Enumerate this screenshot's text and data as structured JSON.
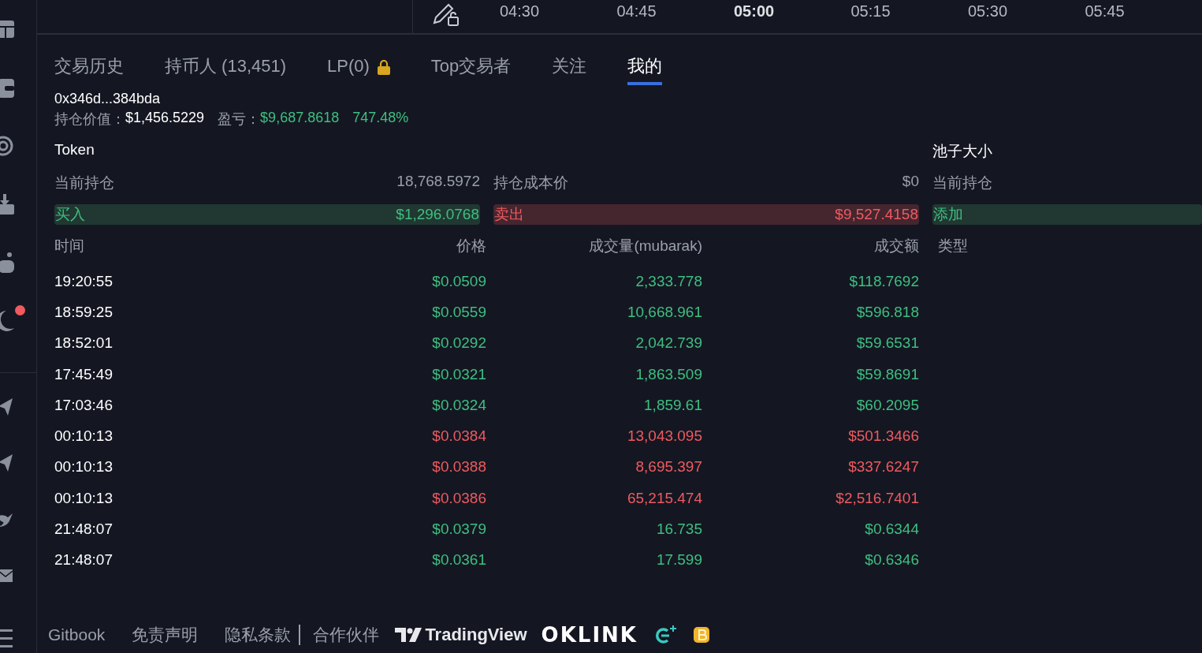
{
  "time_axis": [
    {
      "label": "04:30",
      "emphasized": false
    },
    {
      "label": "04:45",
      "emphasized": false
    },
    {
      "label": "05:00",
      "emphasized": true
    },
    {
      "label": "05:15",
      "emphasized": false
    },
    {
      "label": "05:30",
      "emphasized": false
    },
    {
      "label": "05:45",
      "emphasized": false
    }
  ],
  "sidebar": {
    "alert": true
  },
  "tabs": [
    {
      "label": "交易历史",
      "selected": false,
      "locked": false
    },
    {
      "label": "持币人 (13,451)",
      "selected": false,
      "locked": false
    },
    {
      "label": "LP(0)",
      "selected": false,
      "locked": true
    },
    {
      "label": "Top交易者",
      "selected": false,
      "locked": false
    },
    {
      "label": "关注",
      "selected": false,
      "locked": false
    },
    {
      "label": "我的",
      "selected": true,
      "locked": false
    }
  ],
  "wallet": {
    "address": "0x346d...384bda",
    "holding_label": "持仓价值：",
    "holding_value": "$1,456.5229",
    "pnl_label": "盈亏：",
    "pnl_value": "$9,687.8618",
    "pnl_percent": "747.48%"
  },
  "token": {
    "title": "Token",
    "current_label": "当前持仓",
    "current_value": "18,768.5972",
    "cost_label": "持仓成本价",
    "cost_value": "$0",
    "buy_label": "买入",
    "buy_value": "$1,296.0768",
    "sell_label": "卖出",
    "sell_value": "$9,527.4158"
  },
  "pool": {
    "title": "池子大小",
    "current_label": "当前持仓",
    "add_label": "添加"
  },
  "table": {
    "columns": [
      "时间",
      "价格",
      "成交量(mubarak)",
      "成交额",
      "类型"
    ],
    "rows": [
      {
        "time": "19:20:55",
        "price": "$0.0509",
        "volume": "2,333.778",
        "amount": "$118.7692",
        "sell": false
      },
      {
        "time": "18:59:25",
        "price": "$0.0559",
        "volume": "10,668.961",
        "amount": "$596.818",
        "sell": false
      },
      {
        "time": "18:52:01",
        "price": "$0.0292",
        "volume": "2,042.739",
        "amount": "$59.6531",
        "sell": false
      },
      {
        "time": "17:45:49",
        "price": "$0.0321",
        "volume": "1,863.509",
        "amount": "$59.8691",
        "sell": false
      },
      {
        "time": "17:03:46",
        "price": "$0.0324",
        "volume": "1,859.61",
        "amount": "$60.2095",
        "sell": false
      },
      {
        "time": "00:10:13",
        "price": "$0.0384",
        "volume": "13,043.095",
        "amount": "$501.3466",
        "sell": true
      },
      {
        "time": "00:10:13",
        "price": "$0.0388",
        "volume": "8,695.397",
        "amount": "$337.6247",
        "sell": true
      },
      {
        "time": "00:10:13",
        "price": "$0.0386",
        "volume": "65,215.474",
        "amount": "$2,516.7401",
        "sell": true
      },
      {
        "time": "21:48:07",
        "price": "$0.0379",
        "volume": "16.735",
        "amount": "$0.6344",
        "sell": false
      },
      {
        "time": "21:48:07",
        "price": "$0.0361",
        "volume": "17.599",
        "amount": "$0.6346",
        "sell": false
      }
    ]
  },
  "footer": {
    "links": [
      "Gitbook",
      "免责声明",
      "隐私条款"
    ],
    "partners_label": "合作伙伴",
    "tradingview": "TradingView",
    "oklink": "OKLINK"
  }
}
